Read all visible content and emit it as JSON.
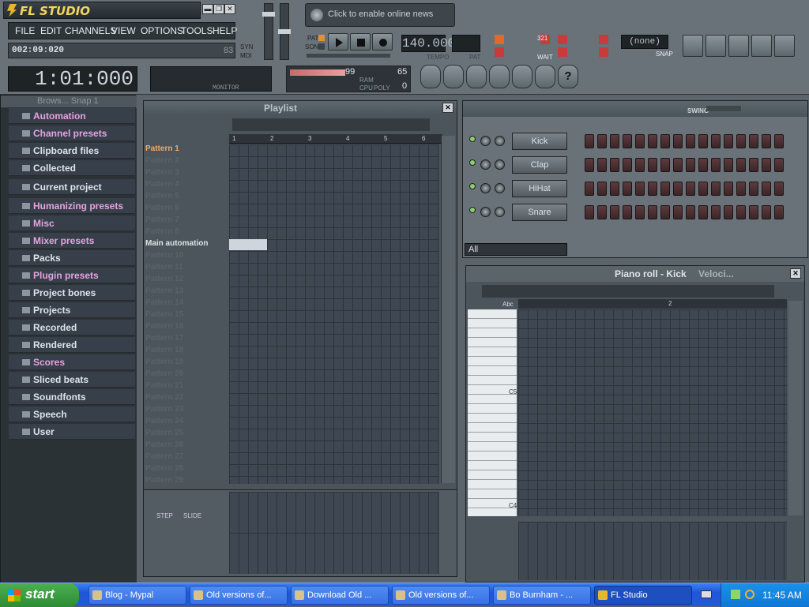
{
  "app": {
    "title": "FL STUDIO",
    "window_controls": {
      "minimize": "▬",
      "restore": "❐",
      "close": "✕"
    }
  },
  "menu": [
    "FILE",
    "EDIT",
    "CHANNELS",
    "VIEW",
    "OPTIONS",
    "TOOLS",
    "HELP"
  ],
  "header": {
    "song_time": "002:09:020",
    "cpu_small": "83",
    "big_time": "1:01:000",
    "news": "Click to enable online news",
    "tempo": "140.000",
    "tempo_label": "TEMPO",
    "pat_label": "PAT",
    "song_label": "SONG",
    "snap_value": "(none)",
    "snap_label": "SNAP",
    "monitor_label": "MONITOR",
    "ram_value": "65",
    "vol_value": "99",
    "poly_value": "0",
    "cpu_label": "CPU",
    "ram_label": "RAM",
    "poly_label": "POLY",
    "syn_label": "SYN",
    "mdi_label": "MDI",
    "wait_label": "WAIT",
    "pat_small": "PAT",
    "counter_value": "321"
  },
  "browser": {
    "title": "Brows... Snap 1",
    "items": [
      {
        "label": "Automation",
        "color": "#e6a2e0"
      },
      {
        "label": "Channel presets",
        "color": "#e6a2e0"
      },
      {
        "label": "Clipboard files",
        "color": "#dde3ea"
      },
      {
        "label": "Collected",
        "color": "#dde3ea"
      },
      {
        "label": "Current project",
        "color": "#dde3ea"
      },
      {
        "label": "Humanizing presets",
        "color": "#e6a2e0"
      },
      {
        "label": "Misc",
        "color": "#e6a2e0"
      },
      {
        "label": "Mixer presets",
        "color": "#e6a2e0"
      },
      {
        "label": "Packs",
        "color": "#dde3ea"
      },
      {
        "label": "Plugin presets",
        "color": "#e6a2e0"
      },
      {
        "label": "Project bones",
        "color": "#dde3ea"
      },
      {
        "label": "Projects",
        "color": "#dde3ea"
      },
      {
        "label": "Recorded",
        "color": "#dde3ea"
      },
      {
        "label": "Rendered",
        "color": "#dde3ea"
      },
      {
        "label": "Scores",
        "color": "#e6a2e0"
      },
      {
        "label": "Sliced beats",
        "color": "#dde3ea"
      },
      {
        "label": "Soundfonts",
        "color": "#dde3ea"
      },
      {
        "label": "Speech",
        "color": "#dde3ea"
      },
      {
        "label": "User",
        "color": "#dde3ea"
      }
    ]
  },
  "playlist": {
    "title": "Playlist",
    "bar_numbers": [
      "1",
      "2",
      "3",
      "4",
      "5",
      "6"
    ],
    "patterns": [
      "Pattern 1",
      "Pattern 2",
      "Pattern 3",
      "Pattern 4",
      "Pattern 5",
      "Pattern 6",
      "Pattern 7",
      "Pattern 8",
      "Main automation",
      "Pattern 10",
      "Pattern 11",
      "Pattern 12",
      "Pattern 13",
      "Pattern 14",
      "Pattern 15",
      "Pattern 16",
      "Pattern 17",
      "Pattern 18",
      "Pattern 19",
      "Pattern 20",
      "Pattern 21",
      "Pattern 22",
      "Pattern 23",
      "Pattern 24",
      "Pattern 25",
      "Pattern 26",
      "Pattern 27",
      "Pattern 28",
      "Pattern 29"
    ],
    "step_label": "STEP",
    "slide_label": "SLIDE"
  },
  "step_sequencer": {
    "swing_label": "SWING",
    "channels": [
      "Kick",
      "Clap",
      "HiHat",
      "Snare"
    ],
    "filter": "All"
  },
  "piano_roll": {
    "title": "Piano roll - Kick",
    "subtitle": "Veloci...",
    "marker": "2",
    "abc": "Abc",
    "octave_top": "C5",
    "octave_bottom": "C4"
  },
  "taskbar": {
    "start": "start",
    "tasks": [
      {
        "label": "Blog - Mypal"
      },
      {
        "label": "Old versions of..."
      },
      {
        "label": "Download Old ..."
      },
      {
        "label": "Old versions of..."
      },
      {
        "label": "Bo Burnham - ..."
      },
      {
        "label": "FL Studio"
      }
    ],
    "clock": "11:45 AM"
  }
}
